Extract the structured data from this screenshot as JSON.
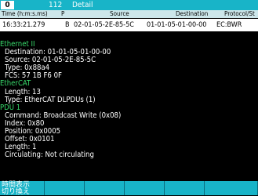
{
  "title_bar": {
    "slot": "0",
    "frame": "112",
    "mode": "Detail"
  },
  "columns": [
    "Time (h:m:s.ms)",
    "P",
    "Source",
    "Destination",
    "Protocol/St"
  ],
  "row": {
    "time": "16:33:21.279",
    "p": "B",
    "source": "02-01-05-2E-85-5C",
    "destination": "01-01-05-01-00-00",
    "protocol": "EC:BWR"
  },
  "detail_lines": [
    {
      "kind": "section",
      "text": "Ethernet II"
    },
    {
      "kind": "field",
      "text": "Destination: 01-01-05-01-00-00"
    },
    {
      "kind": "field",
      "text": "Source: 02-01-05-2E-85-5C"
    },
    {
      "kind": "field",
      "text": "Type: 0x88a4"
    },
    {
      "kind": "field",
      "text": "FCS: 57 1B F6 0F"
    },
    {
      "kind": "section",
      "text": "EtherCAT"
    },
    {
      "kind": "field",
      "text": "Length: 13"
    },
    {
      "kind": "field",
      "text": "Type: EtherCAT DLPDUs (1)"
    },
    {
      "kind": "section",
      "text": "PDU 1"
    },
    {
      "kind": "field",
      "text": "Command: Broadcast Write (0x08)"
    },
    {
      "kind": "field",
      "text": "Index: 0x80"
    },
    {
      "kind": "field",
      "text": "Position: 0x0005"
    },
    {
      "kind": "field",
      "text": "Offset: 0x0101"
    },
    {
      "kind": "field",
      "text": "Length: 1"
    },
    {
      "kind": "field",
      "text": "Circulating: Not circulating"
    }
  ],
  "function_keys": [
    {
      "line1": "時間表示",
      "line2": " 切り換え"
    },
    {
      "line1": "",
      "line2": ""
    },
    {
      "line1": "",
      "line2": ""
    },
    {
      "line1": "",
      "line2": ""
    },
    {
      "line1": "",
      "line2": ""
    },
    {
      "line1": "",
      "line2": ""
    }
  ]
}
